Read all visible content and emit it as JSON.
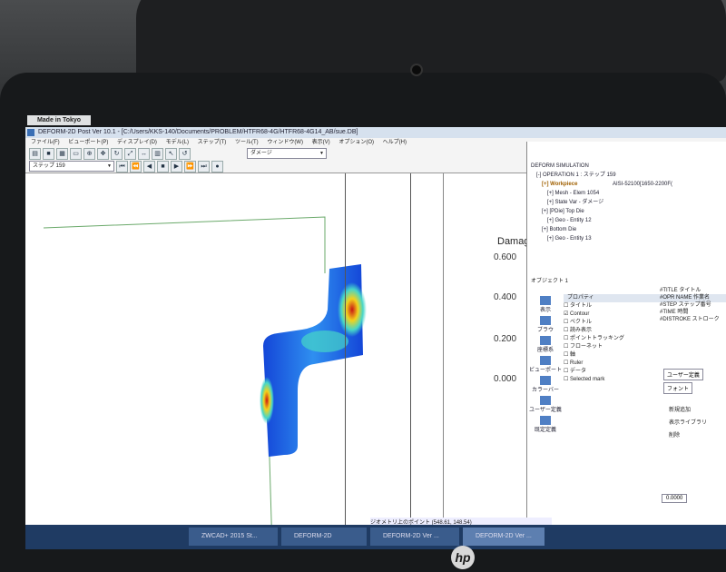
{
  "device": {
    "made_in": "Made in Tokyo",
    "brand": "hp"
  },
  "window": {
    "title": "DEFORM-2D Post Ver 10.1 - [C:/Users/KKS-140/Documents/PROBLEM/HTFR68-4G/HTFR68-4G14_AB/sue.DB]"
  },
  "menu": [
    "ファイル(F)",
    "ビューポート(P)",
    "ディスプレイ(D)",
    "モデル(L)",
    "ステップ(T)",
    "ツール(T)",
    "ウィンドウ(W)",
    "表示(V)",
    "オプション(O)",
    "ヘルプ(H)"
  ],
  "toolbar": {
    "step_select": "ステップ 159",
    "display_select": "ダメージ"
  },
  "legend": {
    "title": "Damage",
    "ticks": [
      "0.600",
      "0.400",
      "0.200",
      "0.000"
    ],
    "range": [
      0.0,
      0.6
    ],
    "colors": [
      "#c81414",
      "#f3d21c",
      "#46d6c8",
      "#1446d8"
    ]
  },
  "tree": {
    "root": "DEFORM SIMULATION",
    "operation": "[-] OPERATION 1 : ステップ 159",
    "workpiece": "[+] Workpiece",
    "material": "AISI-52100[1650-2200F(",
    "mesh": "[+] Mesh - Elem 1054",
    "state_var": "[+] State Var - ダメージ",
    "top_die": "[+] [PDie] Top Die",
    "top_geo": "[+] Geo - Entity 12",
    "bottom_die": "[+] Bottom Die",
    "bottom_geo": "[+] Geo - Entity 13"
  },
  "properties": {
    "header": "プロパティ",
    "object_label": "オブジェクト 1",
    "items": [
      "タイトル",
      "Contour",
      "ベクトル",
      "読み表示",
      "ポイントトラッキング",
      "フローネット",
      "軸",
      "Ruler",
      "データ",
      "Selected mark"
    ],
    "side_buttons": [
      "表示",
      "ブラウ",
      "座標系",
      "ビューポート",
      "カラーバー",
      "ユーザー定義",
      "既定定義"
    ],
    "right_text": [
      "#TITLE タイトル",
      "#OPR NAME 作業名",
      "#STEP ステップ番号",
      "#TIME 時間",
      "#DISTROKE ストローク"
    ],
    "font_label": "フォント",
    "user_label": "ユーザー定義",
    "add_label": "新規追加",
    "display_label": "表示ライブラリ",
    "delete_label": "削除",
    "value_zero": "0.0000"
  },
  "status_text": "ジオメトリ上のポイント (548.61, 148.54)",
  "taskbar": {
    "tasks": [
      "ZWCAD+ 2015 St...",
      "DEFORM-2D",
      "DEFORM-2D Ver ...",
      "DEFORM-2D Ver ..."
    ]
  }
}
